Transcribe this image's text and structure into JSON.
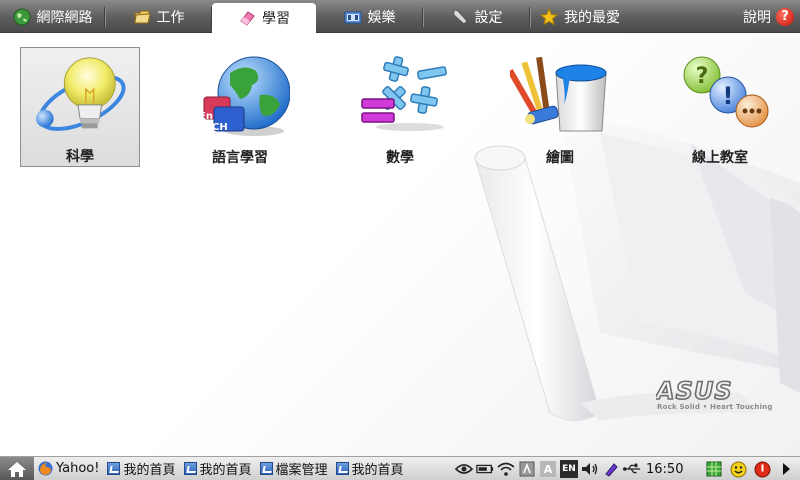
{
  "top_tabs": [
    {
      "label": "網際網路",
      "icon": "globe-icon",
      "active": false
    },
    {
      "label": "工作",
      "icon": "folder-icon",
      "active": false
    },
    {
      "label": "學習",
      "icon": "pink-eraser-icon",
      "active": true
    },
    {
      "label": "娛樂",
      "icon": "media-icon",
      "active": false
    },
    {
      "label": "設定",
      "icon": "wrench-icon",
      "active": false
    },
    {
      "label": "我的最愛",
      "icon": "star-icon",
      "active": false
    }
  ],
  "help_label": "說明",
  "help_glyph": "?",
  "apps": [
    {
      "label": "科學",
      "icon": "lightbulb-icon",
      "selected": true
    },
    {
      "label": "語言學習",
      "icon": "globe-language-icon",
      "selected": false
    },
    {
      "label": "數學",
      "icon": "math-symbols-icon",
      "selected": false
    },
    {
      "label": "繪圖",
      "icon": "paint-bucket-icon",
      "selected": false
    },
    {
      "label": "線上教室",
      "icon": "chat-bubbles-icon",
      "selected": false
    }
  ],
  "language_badges": [
    "En",
    "CH"
  ],
  "brand": {
    "logo": "ASUS",
    "tagline": "Rock Solid • Heart Touching"
  },
  "taskbar": {
    "tasks": [
      {
        "label": "Yahoo!",
        "icon": "firefox-icon"
      },
      {
        "label": "我的首頁",
        "icon": "window-icon"
      },
      {
        "label": "我的首頁",
        "icon": "window-icon"
      },
      {
        "label": "檔案管理",
        "icon": "window-icon"
      },
      {
        "label": "我的首頁",
        "icon": "window-icon"
      }
    ],
    "tray_text": {
      "lang": "EN",
      "ime": "A",
      "clock": "16:50"
    }
  },
  "colors": {
    "accent": "#c4150b",
    "tab_bar": "#5d5d5d",
    "selected_bg": "#dcdcdc"
  }
}
